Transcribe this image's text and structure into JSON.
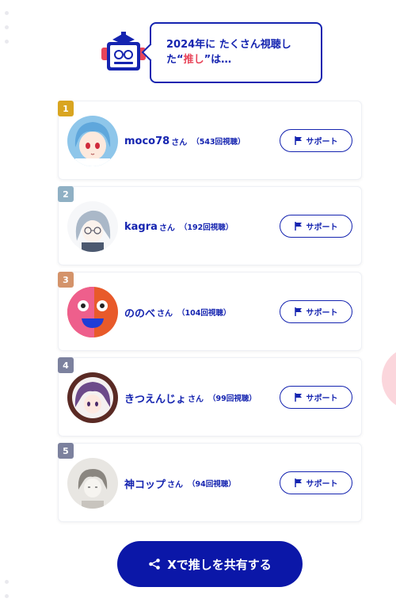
{
  "header": {
    "line1": "2024年に たくさん視聴し",
    "line2_pre": "た",
    "line2_open_quote": "“",
    "line2_highlight": "推し",
    "line2_close_quote": "”",
    "line2_post": "は…",
    "highlight_color": "#e8455a",
    "mascot_icon": "mascot-robot-icon"
  },
  "ranking": [
    {
      "rank": "1",
      "name": "moco78",
      "suffix": "さん",
      "count": "（543回視聴）",
      "badge_color": "#d9a520",
      "support_label": "サポート"
    },
    {
      "rank": "2",
      "name": "kagra",
      "suffix": "さん",
      "count": "（192回視聴）",
      "badge_color": "#8fb0c4",
      "support_label": "サポート"
    },
    {
      "rank": "3",
      "name": "ののべ",
      "suffix": "さん",
      "count": "（104回視聴）",
      "badge_color": "#d4936a",
      "support_label": "サポート"
    },
    {
      "rank": "4",
      "name": "きつえんじょ",
      "suffix": "さん",
      "count": "（99回視聴）",
      "badge_color": "#7c819e",
      "support_label": "サポート"
    },
    {
      "rank": "5",
      "name": "神コップ",
      "suffix": "さん",
      "count": "（94回視聴）",
      "badge_color": "#7c819e",
      "support_label": "サポート"
    }
  ],
  "share": {
    "label": "Xで推しを共有する",
    "icon": "share-icon"
  },
  "colors": {
    "primary": "#1524b0",
    "button_bg": "#0b17a8"
  }
}
